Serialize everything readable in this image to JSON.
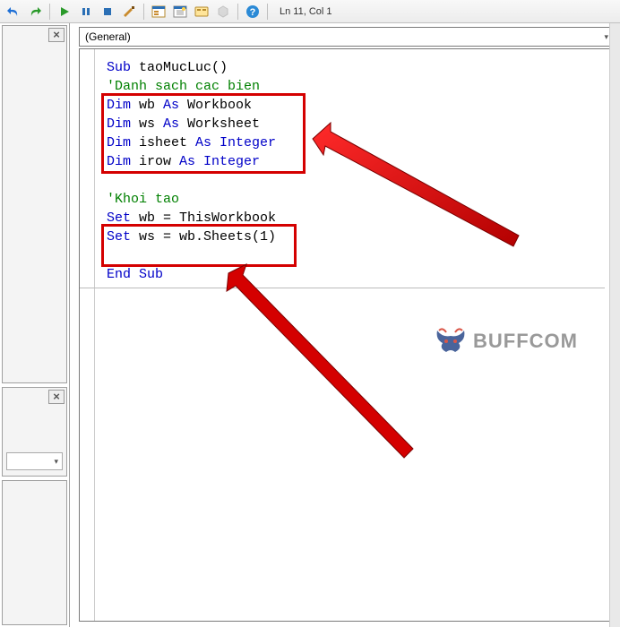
{
  "toolbar": {
    "undo_icon": "undo-icon",
    "redo_icon": "redo-icon",
    "run_icon": "run-icon",
    "break_icon": "break-icon",
    "stop_icon": "stop-icon",
    "design_icon": "design-mode-icon",
    "project_explorer_icon": "project-explorer-icon",
    "properties_icon": "properties-window-icon",
    "object_browser_icon": "object-browser-icon",
    "toolbox_icon": "toolbox-icon",
    "help_icon": "help-icon",
    "cursor_pos": "Ln 11, Col 1"
  },
  "left": {
    "close_label": "×"
  },
  "objectbox": {
    "value": "(General)"
  },
  "code": {
    "l1_kw": "Sub",
    "l1_txt": " taoMucLuc()",
    "l2_cm": "'Danh sach cac bien",
    "l3_kw1": "Dim",
    "l3_mid": " wb ",
    "l3_kw2": "As",
    "l3_end": " Workbook",
    "l4_kw1": "Dim",
    "l4_mid": " ws ",
    "l4_kw2": "As",
    "l4_end": " Worksheet",
    "l5_kw1": "Dim",
    "l5_mid": " isheet ",
    "l5_kw2": "As Integer",
    "l6_kw1": "Dim",
    "l6_mid": " irow ",
    "l6_kw2": "As Integer",
    "l8_cm": "'Khoi tao",
    "l9_kw": "Set",
    "l9_txt": " wb = ThisWorkbook",
    "l10_kw": "Set",
    "l10_txt": " ws = wb.Sheets(1)",
    "l12_kw": "End Sub"
  },
  "watermark": {
    "text": "BUFFCOM"
  }
}
